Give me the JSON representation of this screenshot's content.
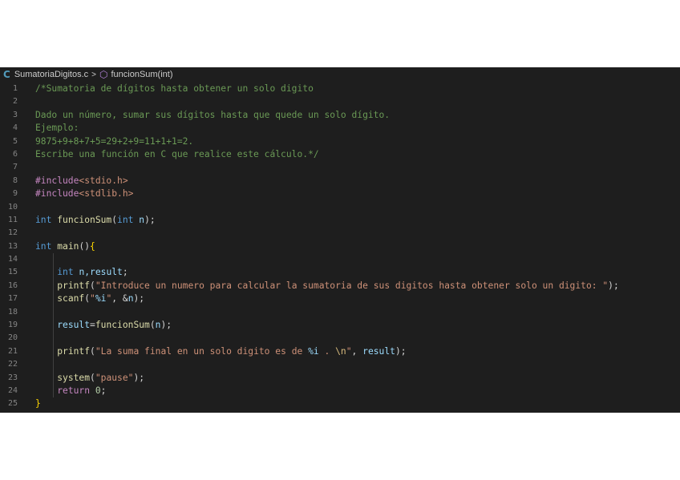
{
  "breadcrumb": {
    "file_icon": "C",
    "file_name": "SumatoriaDigitos.c",
    "separator": ">",
    "symbol_icon": "⬡",
    "symbol_name": "funcionSum(int)"
  },
  "colors": {
    "editor_bg": "#1e1e1e",
    "comment": "#6a9955",
    "keyword": "#569cd6",
    "preprocessor": "#c586c0",
    "function": "#dcdcaa",
    "variable": "#9cdcfe",
    "string": "#ce9178",
    "number": "#b5cea8",
    "brace": "#ffd700"
  },
  "code": {
    "line_numbers": [
      "1",
      "2",
      "3",
      "4",
      "5",
      "6",
      "7",
      "8",
      "9",
      "10",
      "11",
      "12",
      "13",
      "14",
      "15",
      "16",
      "17",
      "18",
      "19",
      "20",
      "21",
      "22",
      "23",
      "24",
      "25"
    ],
    "l1": "/*Sumatoria de dígitos hasta obtener un solo digito",
    "l3": "Dado un número, sumar sus dígitos hasta que quede un solo dígito.",
    "l4": "Ejemplo:",
    "l5": "9875+9+8+7+5=29+2+9=11+1+1=2.",
    "l6": "Escribe una función en C que realice este cálculo.*/",
    "l8_kw": "#include",
    "l8_hdr": "<stdio.h>",
    "l9_kw": "#include",
    "l9_hdr": "<stdlib.h>",
    "l11_type": "int",
    "l11_fn": "funcionSum",
    "l11_open": "(",
    "l11_ptype": "int",
    "l11_param": "n",
    "l11_close": ");",
    "l13_type": "int",
    "l13_fn": "main",
    "l13_paren": "()",
    "l13_brace": "{",
    "l15_type": "int",
    "l15_vars": "n,result",
    "l15_end": ";",
    "l16_fn": "printf",
    "l16_open": "(",
    "l16_str": "\"Introduce un numero para calcular la sumatoria de sus digitos hasta obtener solo un digito: \"",
    "l16_close": ");",
    "l17_fn": "scanf",
    "l17_open": "(",
    "l17_str_a": "\"",
    "l17_fmt": "%i",
    "l17_str_b": "\"",
    "l17_comma": ", &",
    "l17_var": "n",
    "l17_close": ");",
    "l19_var": "result",
    "l19_eq": "=",
    "l19_fn": "funcionSum",
    "l19_open": "(",
    "l19_arg": "n",
    "l19_close": ");",
    "l21_fn": "printf",
    "l21_open": "(",
    "l21_str_a": "\"La suma final en un solo digito es de ",
    "l21_fmt": "%i",
    "l21_str_b": " . ",
    "l21_esc": "\\n",
    "l21_str_c": "\"",
    "l21_comma": ", ",
    "l21_var": "result",
    "l21_close": ");",
    "l23_fn": "system",
    "l23_open": "(",
    "l23_str": "\"pause\"",
    "l23_close": ");",
    "l24_kw": "return",
    "l24_num": "0",
    "l24_end": ";",
    "l25_brace": "}"
  }
}
